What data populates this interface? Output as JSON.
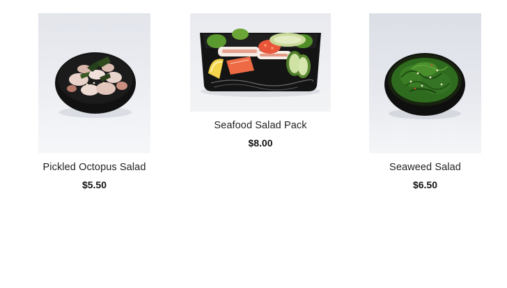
{
  "products": [
    {
      "name": "Pickled Octopus Salad",
      "price": "$5.50",
      "image_icon": "octopus-salad-bowl-image"
    },
    {
      "name": "Seafood Salad Pack",
      "price": "$8.00",
      "image_icon": "seafood-salad-tray-image"
    },
    {
      "name": "Seaweed Salad",
      "price": "$6.50",
      "image_icon": "seaweed-salad-bowl-image"
    }
  ],
  "colors": {
    "bowl": "#141414",
    "seaweed": "#2f6b1e",
    "salmon": "#e8553a",
    "octopus": "#e6cfc8"
  }
}
